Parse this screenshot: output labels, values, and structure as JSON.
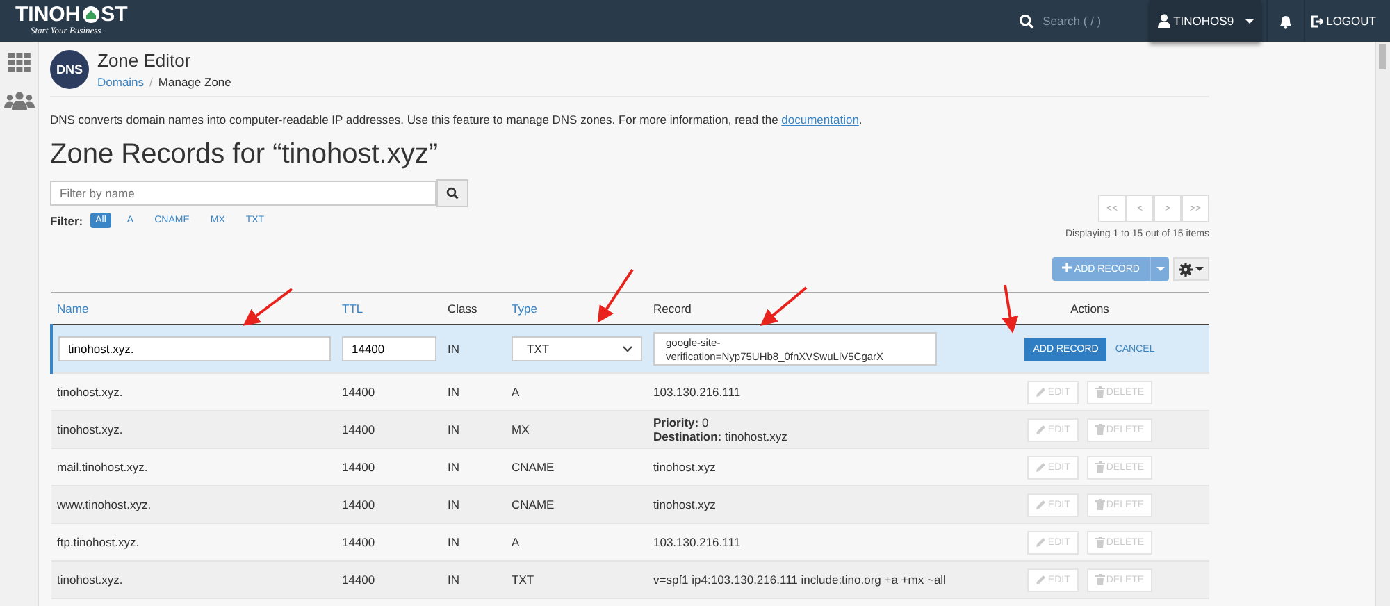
{
  "topbar": {
    "logo": {
      "text_before": "TINOH",
      "text_after": "ST",
      "tagline": "Start Your Business"
    },
    "search": {
      "placeholder": "Search ( / )"
    },
    "user": "TINOHOS9",
    "logout": "LOGOUT"
  },
  "header": {
    "icon_label": "DNS",
    "title": "Zone Editor",
    "separator": "/",
    "breadcrumb": [
      {
        "label": "Domains",
        "kind": "link"
      },
      {
        "label": "Manage Zone",
        "kind": "current"
      }
    ]
  },
  "description": {
    "text": "DNS converts domain names into computer-readable IP addresses. Use this feature to manage DNS zones. For more information, read the",
    "link": "documentation",
    "end": "."
  },
  "heading": "Zone Records for “tinohost.xyz”",
  "filter": {
    "placeholder": "Filter by name",
    "label": "Filter:",
    "chips": [
      {
        "label": "All",
        "selected": true
      },
      {
        "label": "A",
        "selected": false
      },
      {
        "label": "CNAME",
        "selected": false
      },
      {
        "label": "MX",
        "selected": false
      },
      {
        "label": "TXT",
        "selected": false
      }
    ]
  },
  "pagination": {
    "buttons": [
      "<<",
      "<",
      ">",
      ">>"
    ],
    "summary": "Displaying 1 to 15 out of 15 items"
  },
  "add_record_button": "ADD RECORD",
  "table": {
    "columns": [
      {
        "label": "Name",
        "sortable": true
      },
      {
        "label": "TTL",
        "sortable": true
      },
      {
        "label": "Class",
        "sortable": false
      },
      {
        "label": "Type",
        "sortable": true
      },
      {
        "label": "Record",
        "sortable": false
      },
      {
        "label": "Actions",
        "sortable": false
      }
    ],
    "edit_row": {
      "name": "tinohost.xyz.",
      "ttl": "14400",
      "class": "IN",
      "type": "TXT",
      "record": "google-site-verification=Nyp75UHb8_0fnXVSwuLlV5CgarX",
      "add": "ADD RECORD",
      "cancel": "CANCEL"
    },
    "rows": [
      {
        "name": "tinohost.xyz.",
        "ttl": "14400",
        "class": "IN",
        "type": "A",
        "record": [
          "103.130.216.111"
        ],
        "edit": "EDIT",
        "delete": "DELETE"
      },
      {
        "name": "tinohost.xyz.",
        "ttl": "14400",
        "class": "IN",
        "type": "MX",
        "record": [
          "**Priority:** 0",
          "**Destination:** tinohost.xyz"
        ],
        "edit": "EDIT",
        "delete": "DELETE"
      },
      {
        "name": "mail.tinohost.xyz.",
        "ttl": "14400",
        "class": "IN",
        "type": "CNAME",
        "record": [
          "tinohost.xyz"
        ],
        "edit": "EDIT",
        "delete": "DELETE"
      },
      {
        "name": "www.tinohost.xyz.",
        "ttl": "14400",
        "class": "IN",
        "type": "CNAME",
        "record": [
          "tinohost.xyz"
        ],
        "edit": "EDIT",
        "delete": "DELETE"
      },
      {
        "name": "ftp.tinohost.xyz.",
        "ttl": "14400",
        "class": "IN",
        "type": "A",
        "record": [
          "103.130.216.111"
        ],
        "edit": "EDIT",
        "delete": "DELETE"
      },
      {
        "name": "tinohost.xyz.",
        "ttl": "14400",
        "class": "IN",
        "type": "TXT",
        "record": [
          "v=spf1 ip4:103.130.216.111 include:tino.org +a +mx ~all"
        ],
        "edit": "EDIT",
        "delete": "DELETE"
      }
    ]
  }
}
